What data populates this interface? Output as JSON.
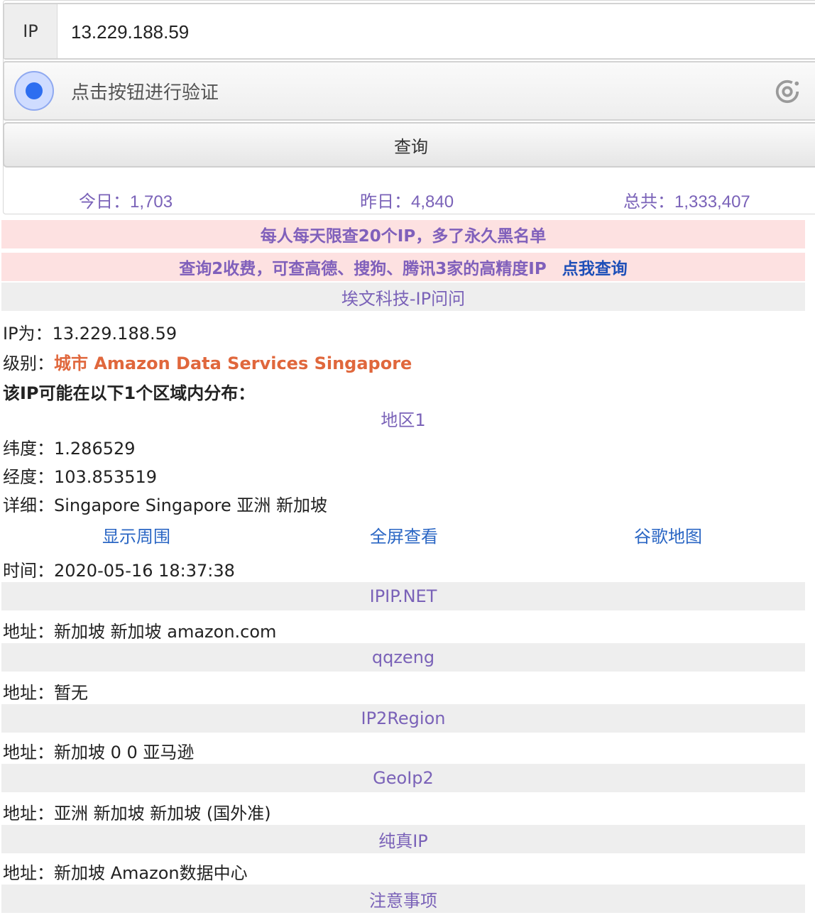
{
  "form": {
    "ip_label": "IP",
    "ip_value": "13.229.188.59",
    "captcha_text": "点击按钮进行验证",
    "query_button": "查询"
  },
  "stats": {
    "today": "今日：1,703",
    "yesterday": "昨日：4,840",
    "total": "总共：1,333,407"
  },
  "banners": {
    "limit": "每人每天限查20个IP，多了永久黑名单",
    "paid": "查询2收费，可查高德、搜狗、腾讯3家的高精度IP",
    "paid_link": "点我查询"
  },
  "site_title": "埃文科技-IP问问",
  "result": {
    "ip_label": "IP为：",
    "ip_value": "13.229.188.59",
    "level_label": "级别：",
    "level_value": "城市 Amazon Data Services Singapore",
    "distribution": "该IP可能在以下1个区域内分布：",
    "region_title": "地区1",
    "lat_label": "纬度：",
    "lat_value": "1.286529",
    "lng_label": "经度：",
    "lng_value": "103.853519",
    "detail_label": "详细：",
    "detail_value": "Singapore Singapore 亚洲 新加坡",
    "links": {
      "around": "显示周围",
      "fullscreen": "全屏查看",
      "google": "谷歌地图"
    },
    "time_label": "时间：",
    "time_value": "2020-05-16 18:37:38"
  },
  "sources": [
    {
      "name": "IPIP.NET",
      "label": "地址：",
      "value": "新加坡 新加坡 amazon.com"
    },
    {
      "name": "qqzeng",
      "label": "地址：",
      "value": "暂无"
    },
    {
      "name": "IP2Region",
      "label": "地址：",
      "value": "新加坡 0 0 亚马逊"
    },
    {
      "name": "GeoIp2",
      "label": "地址：",
      "value": "亚洲 新加坡 新加坡 (国外准)"
    },
    {
      "name": "纯真IP",
      "label": "地址：",
      "value": "新加坡 Amazon数据中心"
    }
  ],
  "notes_title": "注意事项",
  "icons": {
    "captcha": "captcha-dot-icon",
    "refresh": "refresh-icon"
  },
  "colors": {
    "accent_purple": "#7a62b8",
    "link_blue": "#2a66c4",
    "level_orange": "#e0673c",
    "banner_pink": "#fde1e1",
    "section_gray": "#eeeeee"
  }
}
